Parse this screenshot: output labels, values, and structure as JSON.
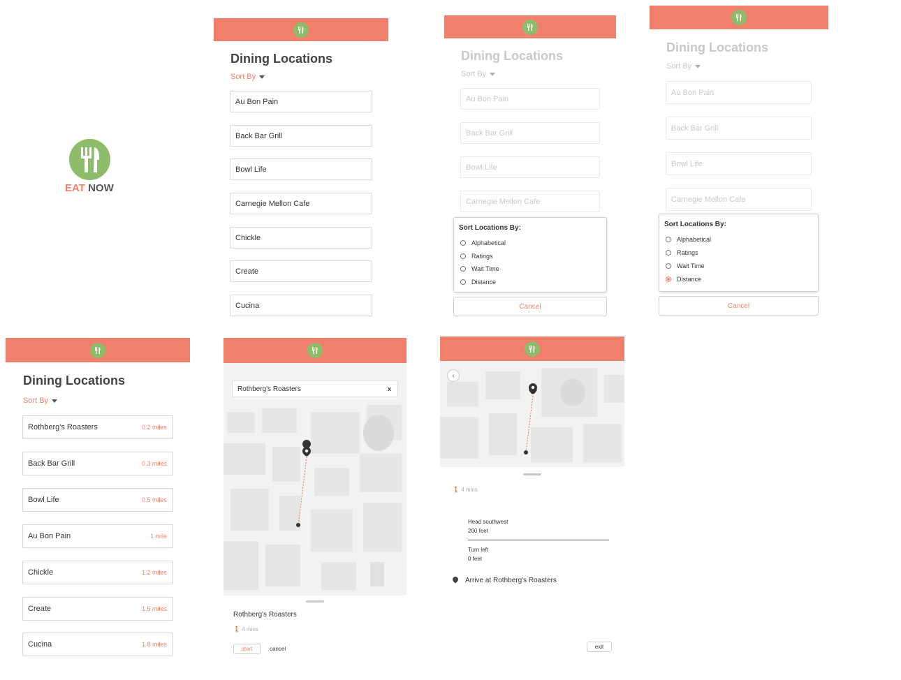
{
  "splash": {
    "brand_part1": "EAT",
    "brand_part2": "NOW",
    "brand_color": "#f0806c",
    "logo_color": "#8dbd6a",
    "logo_icon": "fork-knife-icon"
  },
  "header_color": "#f0806c",
  "list_screen": {
    "title": "Dining Locations",
    "sort_label": "Sort By",
    "items": [
      "Au Bon Pain",
      "Back Bar Grill",
      "Bowl Life",
      "Carnegie Mellon Cafe",
      "Chickle",
      "Create",
      "Cucina"
    ]
  },
  "sort_sheet": {
    "title": "Sort Locations By:",
    "options": [
      "Alphabetical",
      "Ratings",
      "Wait Time",
      "Distance"
    ],
    "cancel_label": "Cancel",
    "selected_in_screen4": "Distance"
  },
  "sorted_screen": {
    "title": "Dining Locations",
    "sort_label": "Sort By",
    "items": [
      {
        "name": "Rothberg's Roasters",
        "distance": "0.2 miles"
      },
      {
        "name": "Back Bar Grill",
        "distance": "0.3 miles"
      },
      {
        "name": "Bowl Life",
        "distance": "0.5 miles"
      },
      {
        "name": "Au Bon Pain",
        "distance": "1 mile"
      },
      {
        "name": "Chickle",
        "distance": "1.2 miles"
      },
      {
        "name": "Create",
        "distance": "1.5 miles"
      },
      {
        "name": "Cucina",
        "distance": "1.8 miles"
      }
    ]
  },
  "map_screen": {
    "search_value": "Rothberg's Roasters",
    "clear_label": "x",
    "destination": "Rothberg's Roasters",
    "walk_time": "4 mins",
    "start_label": "start",
    "cancel_label": "cancel"
  },
  "directions_screen": {
    "back_label": "‹",
    "walk_time": "4 mins",
    "steps": [
      {
        "instruction": "Head southwest",
        "distance": "200 feet"
      },
      {
        "instruction": "Turn left",
        "distance": "0 feet"
      }
    ],
    "arrive": "Arrive at Rothberg's Roasters",
    "exit_label": "exit"
  }
}
